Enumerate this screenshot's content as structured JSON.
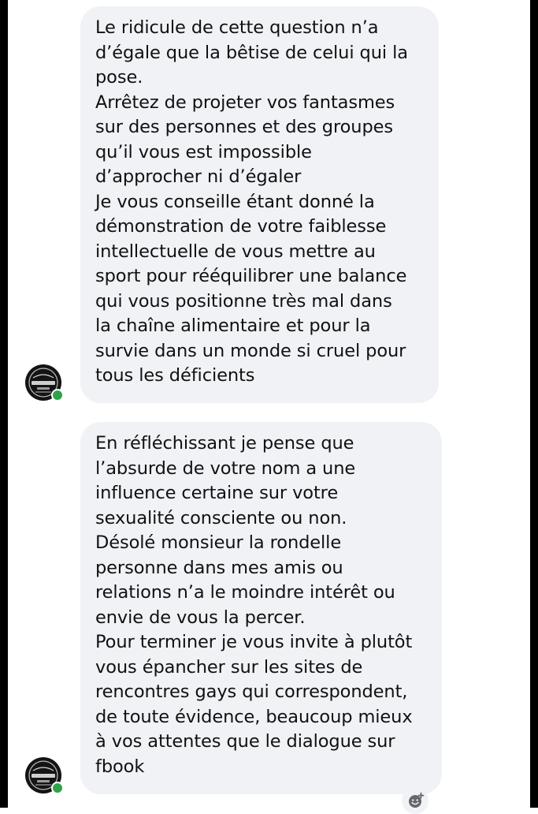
{
  "messages": [
    {
      "lines": [
        "Le ridicule de cette question n’a",
        "d’égale que la bêtise de celui qui la",
        "pose.",
        "Arrêtez de projeter vos fantasmes",
        "sur des personnes et des groupes",
        "qu’il vous est impossible",
        "d’approcher ni d’égaler",
        "Je vous conseille étant donné la",
        "démonstration de votre faiblesse",
        "intellectuelle de vous mettre au",
        "sport pour rééquilibrer une balance",
        "qui vous positionne très mal dans",
        "la chaîne alimentaire et pour la",
        "survie dans un monde si cruel pour",
        "tous les déficients"
      ],
      "sender_online": true
    },
    {
      "lines": [
        "En réfléchissant je pense que",
        "l’absurde de votre nom a une",
        "influence certaine sur votre",
        "sexualité consciente ou non.",
        "Désolé monsieur la rondelle",
        "personne dans mes amis ou",
        "relations n’a le moindre intérêt ou",
        "envie de vous la percer.",
        "Pour terminer je vous invite à plutôt",
        "vous épancher sur les sites de",
        "rencontres gays qui correspondent,",
        "de toute évidence, beaucoup mieux",
        "à vos attentes que le dialogue sur",
        "fbook"
      ],
      "sender_online": true
    }
  ],
  "icons": {
    "avatar": "profile-badge-icon",
    "reaction": "add-reaction-icon"
  },
  "colors": {
    "bubble_bg": "#f1f2f6",
    "online": "#31a24c",
    "text": "#111111"
  }
}
